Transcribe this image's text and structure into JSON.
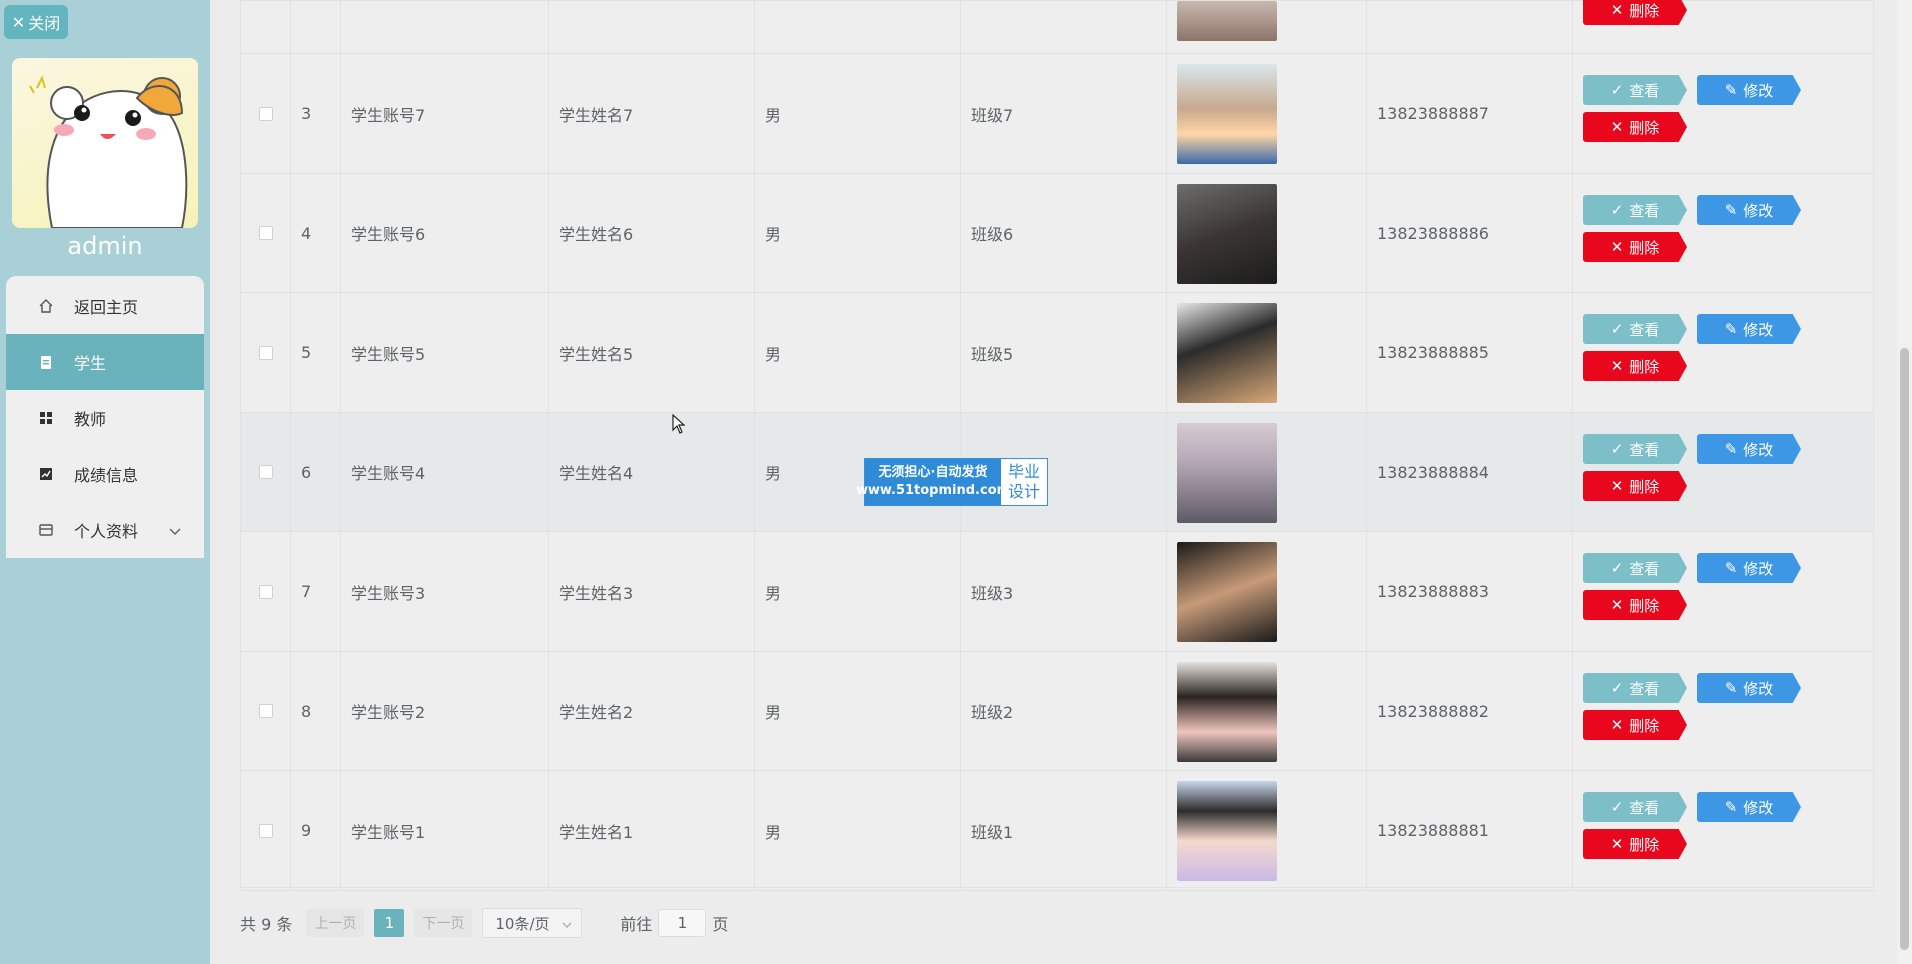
{
  "sidebar": {
    "close_label": "关闭",
    "username": "admin",
    "menu": [
      {
        "label": "返回主页",
        "icon": "home-icon"
      },
      {
        "label": "学生",
        "icon": "clipboard-icon",
        "active": true
      },
      {
        "label": "教师",
        "icon": "grid-icon"
      },
      {
        "label": "成绩信息",
        "icon": "chart-icon"
      },
      {
        "label": "个人资料",
        "icon": "card-icon",
        "expandable": true
      }
    ]
  },
  "table": {
    "rows": [
      {
        "index": "3",
        "account": "学生账号7",
        "name": "学生姓名7",
        "gender": "男",
        "class": "班级7",
        "phone": "13823888887"
      },
      {
        "index": "4",
        "account": "学生账号6",
        "name": "学生姓名6",
        "gender": "男",
        "class": "班级6",
        "phone": "13823888886"
      },
      {
        "index": "5",
        "account": "学生账号5",
        "name": "学生姓名5",
        "gender": "男",
        "class": "班级5",
        "phone": "13823888885"
      },
      {
        "index": "6",
        "account": "学生账号4",
        "name": "学生姓名4",
        "gender": "男",
        "class": "",
        "phone": "13823888884"
      },
      {
        "index": "7",
        "account": "学生账号3",
        "name": "学生姓名3",
        "gender": "男",
        "class": "班级3",
        "phone": "13823888883"
      },
      {
        "index": "8",
        "account": "学生账号2",
        "name": "学生姓名2",
        "gender": "男",
        "class": "班级2",
        "phone": "13823888882"
      },
      {
        "index": "9",
        "account": "学生账号1",
        "name": "学生姓名1",
        "gender": "男",
        "class": "班级1",
        "phone": "13823888881"
      }
    ],
    "view_label": "查看",
    "edit_label": "修改",
    "delete_label": "删除"
  },
  "watermark": {
    "line1": "无须担心·自动发货",
    "line2": "www.51topmind.com",
    "right1": "毕业",
    "right2": "设计"
  },
  "pagination": {
    "total": "共 9 条",
    "prev": "上一页",
    "current": "1",
    "next": "下一页",
    "page_size": "10条/页",
    "goto_prefix": "前往",
    "goto_value": "1",
    "goto_suffix": "页"
  },
  "colors": {
    "sidebar_bg": "#a8d0d6",
    "accent": "#6ab3bd",
    "view_btn": "#7cbfc8",
    "edit_btn": "#3d97e5",
    "delete_btn": "#e8071d"
  }
}
